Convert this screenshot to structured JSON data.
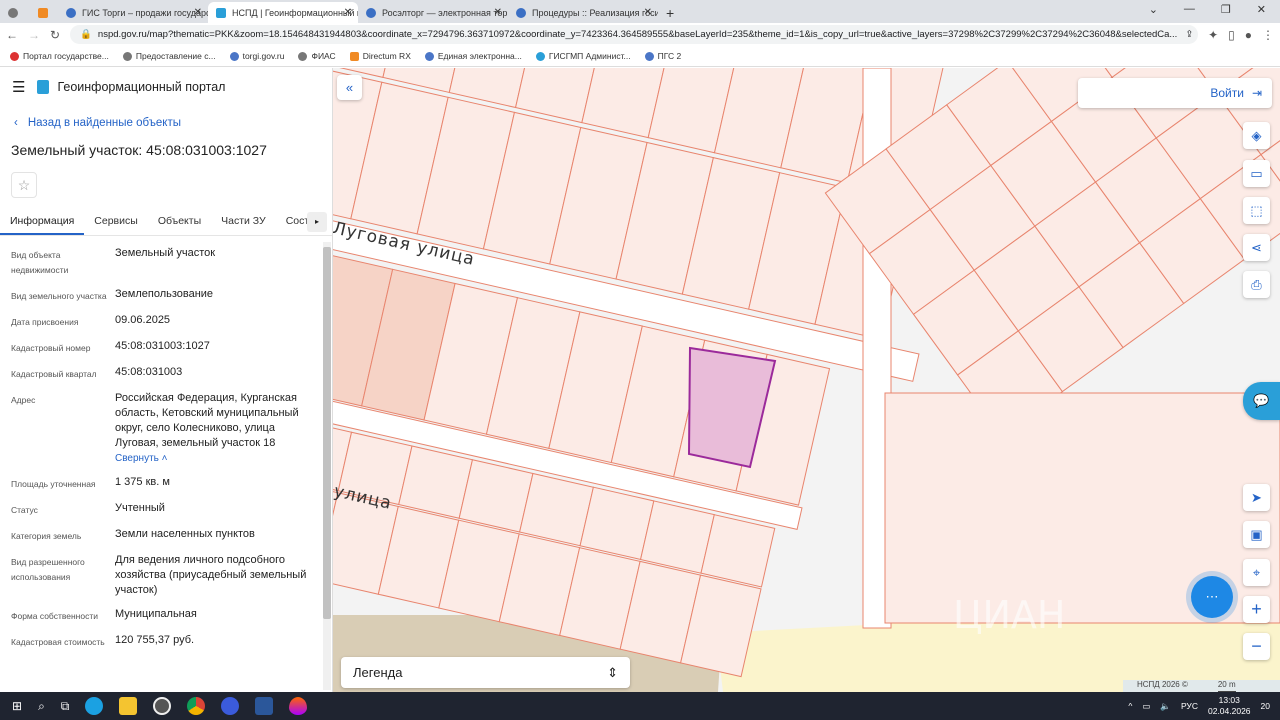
{
  "browser": {
    "tabs": [
      {
        "label": "ГИС Торги – продажи государс"
      },
      {
        "label": "НСПД | Геоинформационный п"
      },
      {
        "label": "Росэлторг — электронная торг"
      },
      {
        "label": "Процедуры :: Реализация госи"
      }
    ],
    "new_tab": "+",
    "url": "nspd.gov.ru/map?thematic=PKK&zoom=18.154648431944803&coordinate_x=7294796.363710972&coordinate_y=7423364.364589555&baseLayerId=235&theme_id=1&is_copy_url=true&active_layers=37298%2C37299%2C37294%2C36048&selectedCa...",
    "bookmarks": [
      "Портал государстве...",
      "Предоставление с...",
      "torgi.gov.ru",
      "ФИАС",
      "Directum RX",
      "Единая электронна...",
      "ГИСГМП Админист...",
      "ПГС 2"
    ]
  },
  "panel": {
    "app_title": "Геоинформационный портал",
    "back_link": "Назад в найденные объекты",
    "title": "Земельный участок: 45:08:031003:1027",
    "tabs": [
      "Информация",
      "Сервисы",
      "Объекты",
      "Части ЗУ",
      "Состав"
    ],
    "fields": [
      {
        "k": "Вид объекта недвижимости",
        "v": "Земельный участок"
      },
      {
        "k": "Вид земельного участка",
        "v": "Землепользование"
      },
      {
        "k": "Дата присвоения",
        "v": "09.06.2025"
      },
      {
        "k": "Кадастровый номер",
        "v": "45:08:031003:1027"
      },
      {
        "k": "Кадастровый квартал",
        "v": "45:08:031003"
      },
      {
        "k": "Адрес",
        "v": "Российская Федерация, Курганская область, Кетовский муниципальный округ, село Колесниково, улица Луговая, земельный участок 18"
      },
      {
        "k": "Площадь уточненная",
        "v": "1 375 кв. м"
      },
      {
        "k": "Статус",
        "v": "Учтенный"
      },
      {
        "k": "Категория земель",
        "v": "Земли населенных пунктов"
      },
      {
        "k": "Вид разрешенного использования",
        "v": "Для ведения личного подсобного хозяйства (приусадебный земельный участок)"
      },
      {
        "k": "Форма собственности",
        "v": "Муниципальная"
      },
      {
        "k": "Кадастровая стоимость",
        "v": "120 755,37 руб."
      }
    ],
    "collapse_link": "Свернуть"
  },
  "map": {
    "street1": "Луговая улица",
    "street2": "улица",
    "login": "Войти",
    "legend": "Легенда",
    "copyright": "НСПД 2026 ©",
    "scale": "20 m",
    "watermark": "ЦИАН"
  },
  "taskbar": {
    "lang": "РУС",
    "time": "13:03",
    "date": "02.04.2026",
    "notif": "20"
  }
}
